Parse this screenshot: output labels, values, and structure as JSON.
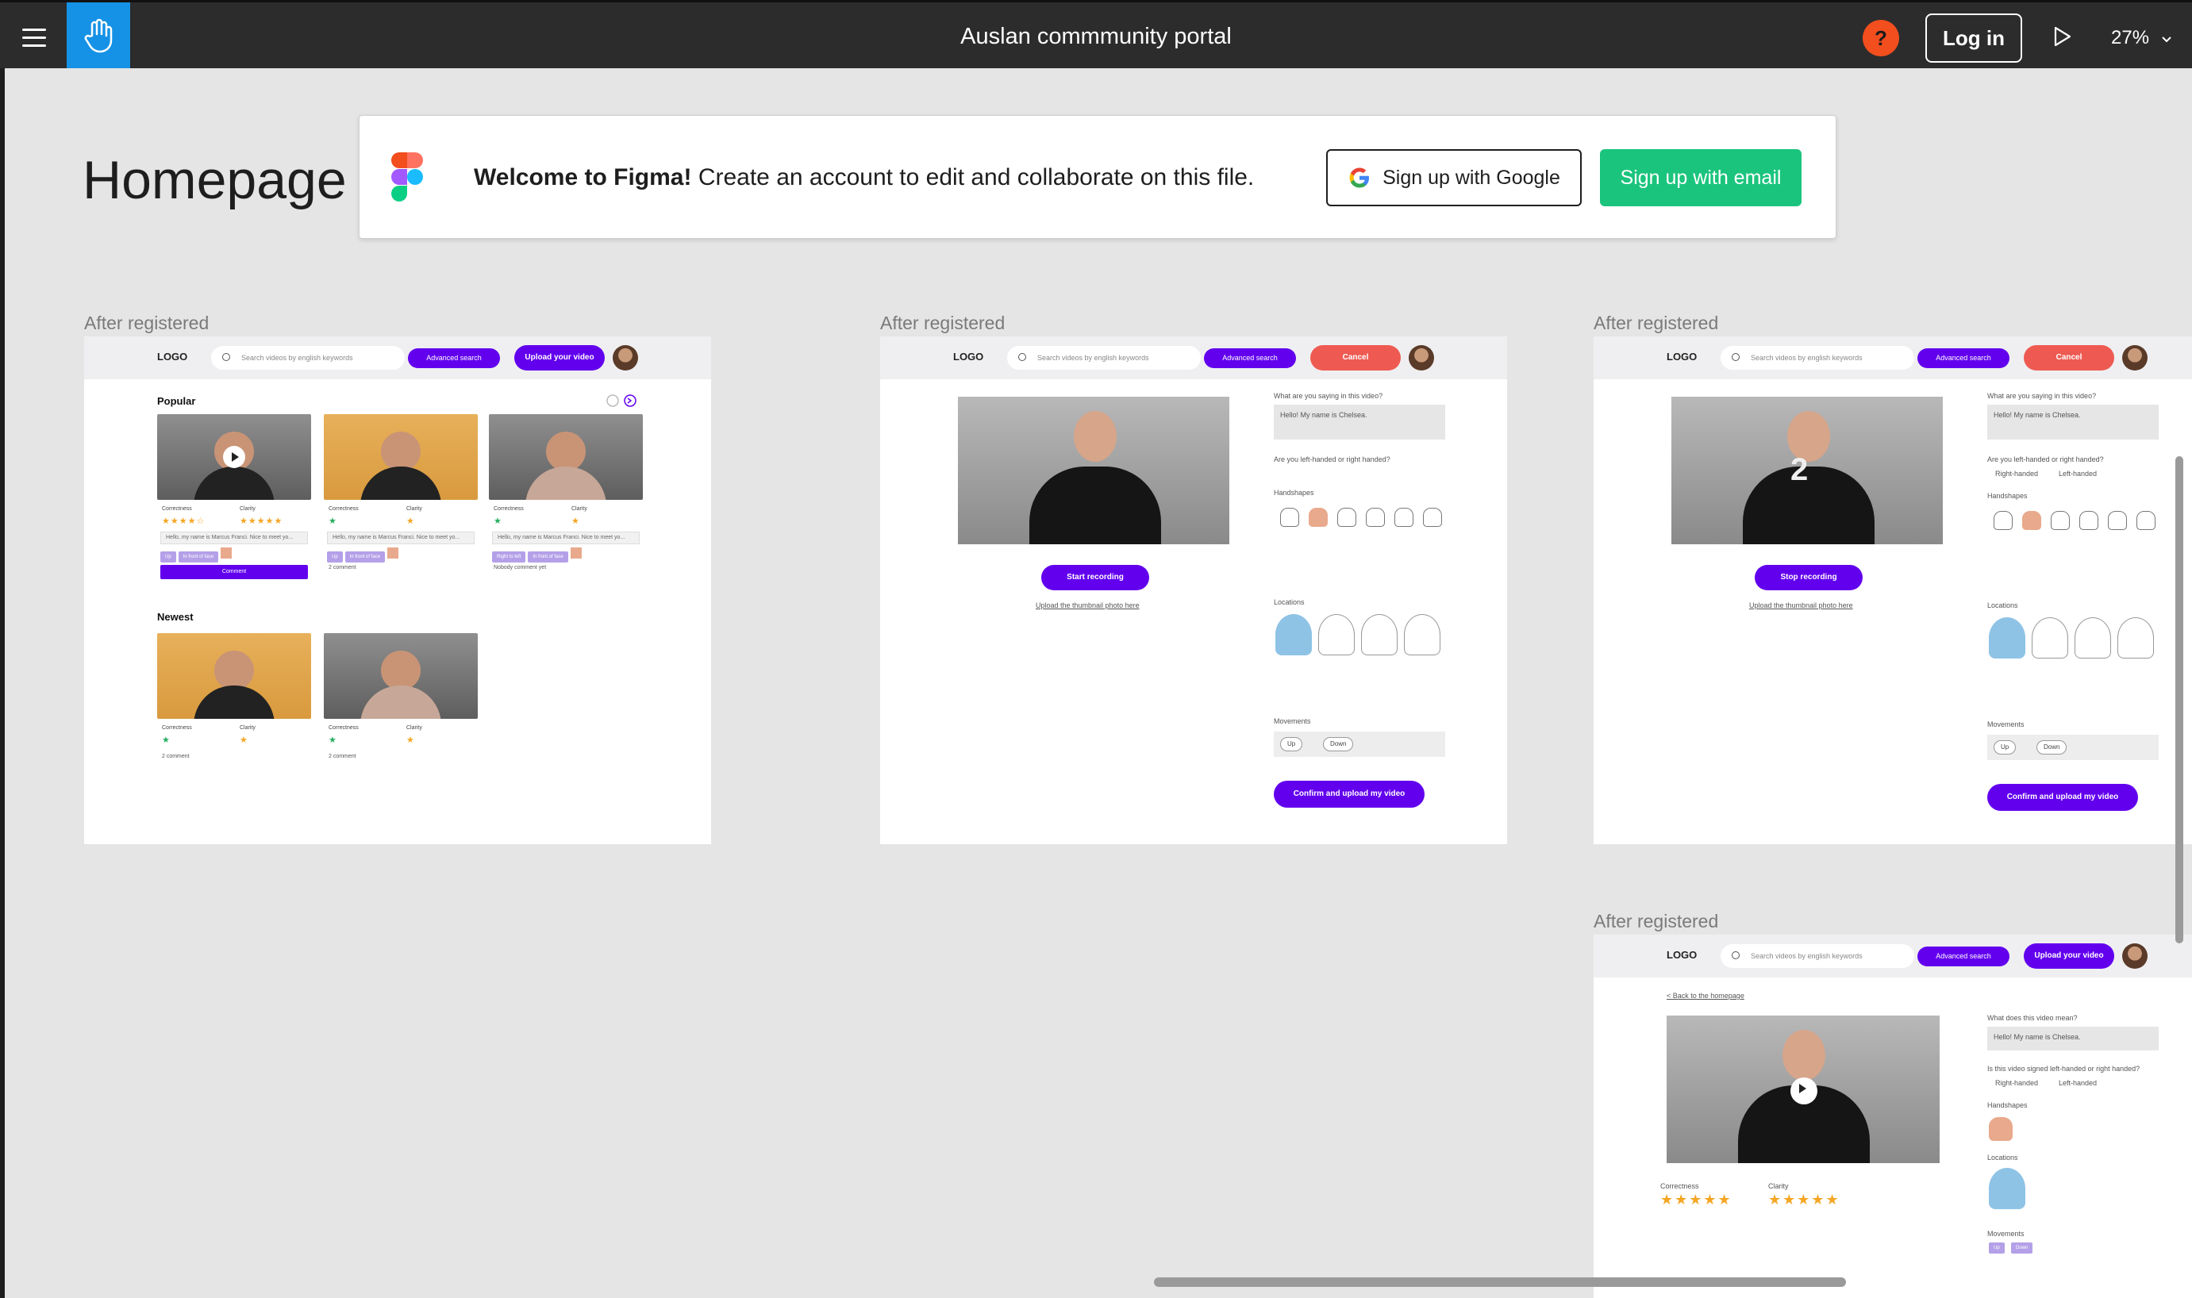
{
  "topbar": {
    "title": "Auslan commmunity portal",
    "help_label": "?",
    "login_label": "Log in",
    "zoom": "27%"
  },
  "page": {
    "title": "Homepage"
  },
  "banner": {
    "welcome_bold": "Welcome to Figma!",
    "welcome_rest": " Create an account to edit and collaborate on this file.",
    "google_label": "Sign up with Google",
    "email_label": "Sign up with email"
  },
  "frames": {
    "label": "After registered",
    "logo": "LOGO",
    "search_placeholder": "Search videos by english keywords",
    "advanced_search": "Advanced search",
    "upload_video": "Upload your video",
    "cancel": "Cancel"
  },
  "home": {
    "popular": "Popular",
    "newest": "Newest",
    "correctness": "Correctness",
    "clarity": "Clarity",
    "desc": "Hello, my name is Marcus Franci. Nice to meet yo...",
    "tag_up": "Up",
    "tag_front": "In front of face",
    "tag_right": "Right to left",
    "comment": "Comment",
    "two_comment": "2 comment",
    "nobody": "Nobody comment yet"
  },
  "upload": {
    "start_recording": "Start recording",
    "stop_recording": "Stop recording",
    "thumbnail_link": "Upload the thumbnail photo here",
    "q_saying": "What are you saying in this video?",
    "answer": "Hello! My name is Chelsea.",
    "q_hand": "Are you left-handed or right handed?",
    "right_handed": "Right-handed",
    "left_handed": "Left-handed",
    "handshapes": "Handshapes",
    "locations": "Locations",
    "movements": "Movements",
    "chip_up": "Up",
    "chip_down": "Down",
    "confirm": "Confirm and upload my video",
    "countdown": "2"
  },
  "detail": {
    "back": "< Back to the  homepage",
    "q_mean": "What does this video mean?",
    "answer": "Hello! My name is Chelsea.",
    "q_signed": "Is this video signed left-handed or right handed?",
    "correctness": "Correctness",
    "clarity": "Clarity",
    "stars_correctness": "★★★★★",
    "stars_clarity": "★★★★★"
  },
  "colors": {
    "accent": "#6200EE",
    "cancel": "#EE5A52",
    "figma_green": "#1BC47D",
    "help": "#F24E1E",
    "tool_blue": "#1592E6"
  },
  "icons": {
    "menu": "hamburger-icon",
    "hand": "hand-tool-icon",
    "play": "present-play-icon",
    "chevron": "chevron-down-icon",
    "google": "google-logo-icon",
    "figma": "figma-logo-icon"
  }
}
